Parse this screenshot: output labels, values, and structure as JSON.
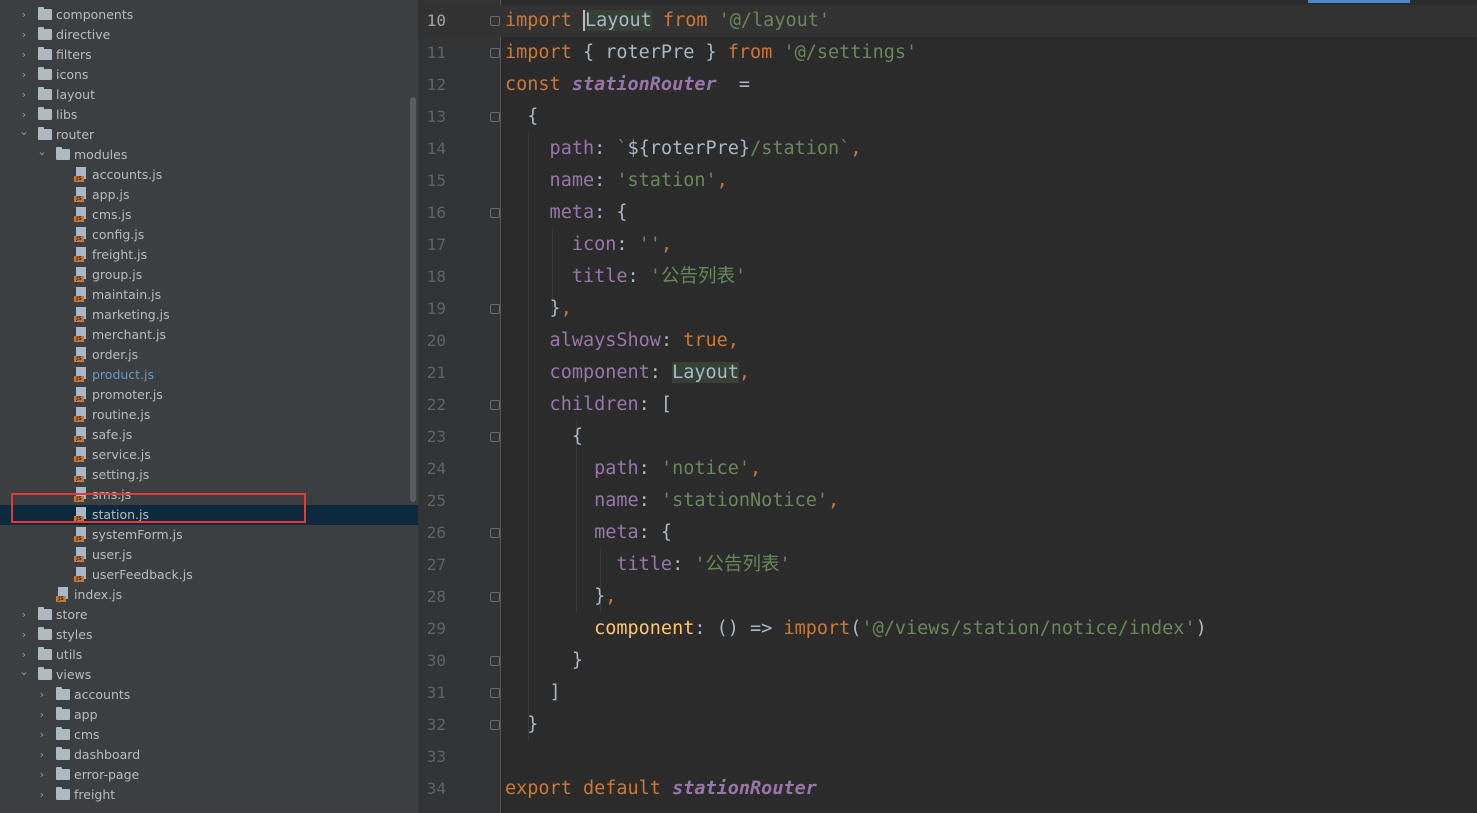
{
  "tree": {
    "selected": "station.js",
    "current": "product.js",
    "items": [
      {
        "label": "components",
        "type": "folder",
        "depth": 1,
        "expanded": false
      },
      {
        "label": "directive",
        "type": "folder",
        "depth": 1,
        "expanded": false
      },
      {
        "label": "filters",
        "type": "folder",
        "depth": 1,
        "expanded": false
      },
      {
        "label": "icons",
        "type": "folder",
        "depth": 1,
        "expanded": false
      },
      {
        "label": "layout",
        "type": "folder",
        "depth": 1,
        "expanded": false
      },
      {
        "label": "libs",
        "type": "folder",
        "depth": 1,
        "expanded": false
      },
      {
        "label": "router",
        "type": "folder",
        "depth": 1,
        "expanded": true
      },
      {
        "label": "modules",
        "type": "folder",
        "depth": 2,
        "expanded": true
      },
      {
        "label": "accounts.js",
        "type": "js",
        "depth": 3
      },
      {
        "label": "app.js",
        "type": "js",
        "depth": 3
      },
      {
        "label": "cms.js",
        "type": "js",
        "depth": 3
      },
      {
        "label": "config.js",
        "type": "js",
        "depth": 3
      },
      {
        "label": "freight.js",
        "type": "js",
        "depth": 3
      },
      {
        "label": "group.js",
        "type": "js",
        "depth": 3
      },
      {
        "label": "maintain.js",
        "type": "js",
        "depth": 3
      },
      {
        "label": "marketing.js",
        "type": "js",
        "depth": 3
      },
      {
        "label": "merchant.js",
        "type": "js",
        "depth": 3
      },
      {
        "label": "order.js",
        "type": "js",
        "depth": 3
      },
      {
        "label": "product.js",
        "type": "js",
        "depth": 3
      },
      {
        "label": "promoter.js",
        "type": "js",
        "depth": 3
      },
      {
        "label": "routine.js",
        "type": "js",
        "depth": 3
      },
      {
        "label": "safe.js",
        "type": "js",
        "depth": 3
      },
      {
        "label": "service.js",
        "type": "js",
        "depth": 3
      },
      {
        "label": "setting.js",
        "type": "js",
        "depth": 3
      },
      {
        "label": "sms.js",
        "type": "js",
        "depth": 3
      },
      {
        "label": "station.js",
        "type": "js",
        "depth": 3
      },
      {
        "label": "systemForm.js",
        "type": "js",
        "depth": 3
      },
      {
        "label": "user.js",
        "type": "js",
        "depth": 3
      },
      {
        "label": "userFeedback.js",
        "type": "js",
        "depth": 3
      },
      {
        "label": "index.js",
        "type": "js",
        "depth": 2
      },
      {
        "label": "store",
        "type": "folder",
        "depth": 1,
        "expanded": false
      },
      {
        "label": "styles",
        "type": "folder",
        "depth": 1,
        "expanded": false
      },
      {
        "label": "utils",
        "type": "folder",
        "depth": 1,
        "expanded": false
      },
      {
        "label": "views",
        "type": "folder",
        "depth": 1,
        "expanded": true
      },
      {
        "label": "accounts",
        "type": "folder",
        "depth": 2,
        "expanded": false
      },
      {
        "label": "app",
        "type": "folder",
        "depth": 2,
        "expanded": false
      },
      {
        "label": "cms",
        "type": "folder",
        "depth": 2,
        "expanded": false
      },
      {
        "label": "dashboard",
        "type": "folder",
        "depth": 2,
        "expanded": false
      },
      {
        "label": "error-page",
        "type": "folder",
        "depth": 2,
        "expanded": false
      },
      {
        "label": "freight",
        "type": "folder",
        "depth": 2,
        "expanded": false
      }
    ]
  },
  "editor": {
    "caret_line": 10,
    "lines": [
      {
        "n": "10",
        "fold": true,
        "tokens": [
          [
            "kw",
            "import "
          ],
          [
            "cursorhl",
            "Layout"
          ],
          [
            "kw",
            " from "
          ],
          [
            "str",
            "'@/layout'"
          ]
        ]
      },
      {
        "n": "11",
        "fold": true,
        "tokens": [
          [
            "kw",
            "import "
          ],
          [
            "p",
            "{ roterPre } "
          ],
          [
            "kw",
            "from "
          ],
          [
            "str",
            "'@/settings'"
          ]
        ]
      },
      {
        "n": "12",
        "fold": false,
        "tokens": [
          [
            "kw",
            "const "
          ],
          [
            "ident",
            "stationRouter"
          ],
          [
            "p",
            "  ="
          ]
        ]
      },
      {
        "n": "13",
        "fold": true,
        "tokens": [
          [
            "p",
            "  {"
          ]
        ]
      },
      {
        "n": "14",
        "fold": false,
        "tokens": [
          [
            "prop",
            "    path"
          ],
          [
            "p",
            ": "
          ],
          [
            "str",
            "`"
          ],
          [
            "p",
            "${roterPre}"
          ],
          [
            "str",
            "/station`"
          ],
          [
            "kw",
            ","
          ]
        ]
      },
      {
        "n": "15",
        "fold": false,
        "tokens": [
          [
            "prop",
            "    name"
          ],
          [
            "p",
            ": "
          ],
          [
            "str",
            "'station'"
          ],
          [
            "kw",
            ","
          ]
        ]
      },
      {
        "n": "16",
        "fold": true,
        "tokens": [
          [
            "prop",
            "    meta"
          ],
          [
            "p",
            ": {"
          ]
        ]
      },
      {
        "n": "17",
        "fold": false,
        "tokens": [
          [
            "prop",
            "      icon"
          ],
          [
            "p",
            ": "
          ],
          [
            "str",
            "''"
          ],
          [
            "kw",
            ","
          ]
        ]
      },
      {
        "n": "18",
        "fold": false,
        "tokens": [
          [
            "prop",
            "      title"
          ],
          [
            "p",
            ": "
          ],
          [
            "str",
            "'公告列表'"
          ]
        ]
      },
      {
        "n": "19",
        "fold": true,
        "tokens": [
          [
            "p",
            "    }"
          ],
          [
            "kw",
            ","
          ]
        ]
      },
      {
        "n": "20",
        "fold": false,
        "tokens": [
          [
            "prop",
            "    alwaysShow"
          ],
          [
            "p",
            ": "
          ],
          [
            "kw",
            "true,"
          ]
        ]
      },
      {
        "n": "21",
        "fold": false,
        "tokens": [
          [
            "prop",
            "    component"
          ],
          [
            "p",
            ": "
          ],
          [
            "hl",
            "Layout"
          ],
          [
            "kw",
            ","
          ]
        ]
      },
      {
        "n": "22",
        "fold": true,
        "tokens": [
          [
            "prop",
            "    children"
          ],
          [
            "p",
            ": ["
          ]
        ]
      },
      {
        "n": "23",
        "fold": true,
        "tokens": [
          [
            "p",
            "      {"
          ]
        ]
      },
      {
        "n": "24",
        "fold": false,
        "tokens": [
          [
            "prop",
            "        path"
          ],
          [
            "p",
            ": "
          ],
          [
            "str",
            "'notice'"
          ],
          [
            "kw",
            ","
          ]
        ]
      },
      {
        "n": "25",
        "fold": false,
        "tokens": [
          [
            "prop",
            "        name"
          ],
          [
            "p",
            ": "
          ],
          [
            "str",
            "'stationNotice'"
          ],
          [
            "kw",
            ","
          ]
        ]
      },
      {
        "n": "26",
        "fold": true,
        "tokens": [
          [
            "prop",
            "        meta"
          ],
          [
            "p",
            ": {"
          ]
        ]
      },
      {
        "n": "27",
        "fold": false,
        "tokens": [
          [
            "prop",
            "          title"
          ],
          [
            "p",
            ": "
          ],
          [
            "str",
            "'公告列表'"
          ]
        ]
      },
      {
        "n": "28",
        "fold": true,
        "tokens": [
          [
            "p",
            "        }"
          ],
          [
            "kw",
            ","
          ]
        ]
      },
      {
        "n": "29",
        "fold": false,
        "tokens": [
          [
            "fn",
            "        component"
          ],
          [
            "p",
            ": () => "
          ],
          [
            "kw",
            "import"
          ],
          [
            "p",
            "("
          ],
          [
            "str",
            "'@/views/station/notice/index'"
          ],
          [
            "p",
            ")"
          ]
        ]
      },
      {
        "n": "30",
        "fold": true,
        "tokens": [
          [
            "p",
            "      }"
          ]
        ]
      },
      {
        "n": "31",
        "fold": true,
        "tokens": [
          [
            "p",
            "    ]"
          ]
        ]
      },
      {
        "n": "32",
        "fold": true,
        "tokens": [
          [
            "p",
            "  }"
          ]
        ]
      },
      {
        "n": "33",
        "fold": false,
        "tokens": []
      },
      {
        "n": "34",
        "fold": false,
        "tokens": [
          [
            "kw",
            "export default "
          ],
          [
            "ident",
            "stationRouter"
          ]
        ]
      }
    ]
  }
}
